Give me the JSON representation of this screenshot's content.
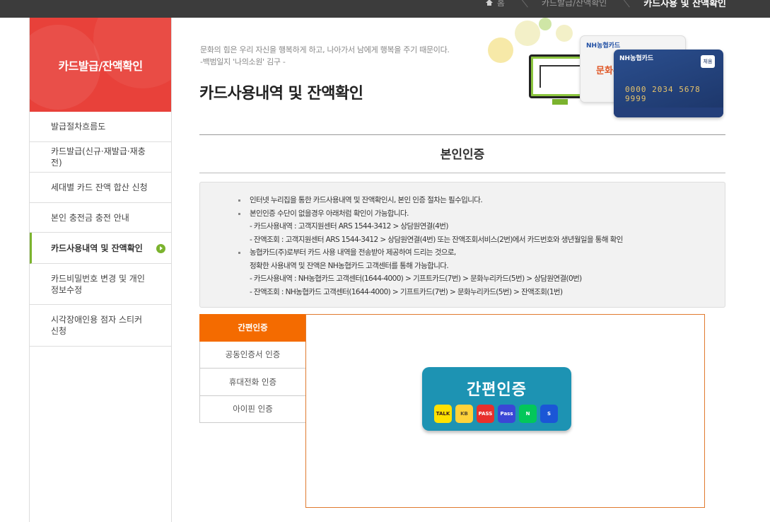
{
  "breadcrumb": {
    "items": [
      "홈",
      "카드발급/잔액확인",
      "카드사용 및 잔액확인"
    ]
  },
  "sidebar": {
    "title": "카드발급/잔액확인",
    "items": [
      {
        "label": "발급절차흐름도"
      },
      {
        "label": "카드발급(신규·재발급·재충전)"
      },
      {
        "label": "세대별 카드 잔액 합산 신청"
      },
      {
        "label": "본인 충전금 충전 안내"
      },
      {
        "label": "카드사용내역 및 잔액확인",
        "active": true
      },
      {
        "label": "카드비밀번호 변경 및 개인\n정보수정"
      },
      {
        "label": "시각장애인용 점자 스티커\n신청"
      }
    ]
  },
  "header": {
    "quote_line1": "문화의 힘은 우리 자신을 행복하게 하고, 나아가서 남에게 행복을 주기 때문이다.",
    "quote_line2": "-백범일지 '나의소원' 김구 -",
    "title": "카드사용내역 및 잔액확인"
  },
  "illustration": {
    "card1_logo": "NH농협카드",
    "card1_brand": "문화누리",
    "card2_logo": "NH농협카드",
    "card2_number": "0000 2034 5678 9999",
    "card2_chip": "체움"
  },
  "section": {
    "title": "본인인증"
  },
  "info": {
    "lines": [
      {
        "text": "인터넷 누리집을 통한 카드사용내역 및 잔액확인시, 본인 인증 절차는 필수입니다.",
        "bullet": true
      },
      {
        "text": "본인인증 수단이 없을경우 아래처럼 확인이 가능합니다.",
        "bullet": true
      },
      {
        "text": "- 카드사용내역 : 고객지원센터 ARS 1544-3412 > 상담원연결(4번)",
        "bullet": false
      },
      {
        "text": "- 잔액조회 : 고객지원센터 ARS 1544-3412 > 상담원연결(4번) 또는 잔액조회서비스(2번)에서 카드번호와 생년월일을 통해 확인",
        "bullet": false
      },
      {
        "text": "농협카드(주)로부터 카드 사용 내역을 전송받아 제공하여 드리는 것으로,",
        "bullet": true
      },
      {
        "text": "정확한 사용내역 및 잔액은 NH농협카드 고객센터를 통해 가능합니다.",
        "bullet": false
      },
      {
        "text": "- 카드사용내역 : NH농협카드 고객센터(1644-4000) > 기프트카드(7번) > 문화누리카드(5번) > 상담원연결(0번)",
        "bullet": false
      },
      {
        "text": "- 잔액조회 : NH농협카드 고객센터(1644-4000) > 기프트카드(7번) > 문화누리카드(5번) > 잔액조회(1번)",
        "bullet": false
      }
    ]
  },
  "auth_tabs": [
    {
      "label": "간편인증",
      "active": true
    },
    {
      "label": "공동인증서 인증"
    },
    {
      "label": "휴대전화 인증"
    },
    {
      "label": "아이핀 인증"
    }
  ],
  "simple_auth": {
    "title": "간편인증",
    "apps": [
      {
        "name": "kakaotalk-icon",
        "label": "TALK",
        "bg": "#ffe100",
        "fg": "#3a1d1d"
      },
      {
        "name": "kb-icon",
        "label": "KB",
        "bg": "#ffd23a",
        "fg": "#5a4a2a"
      },
      {
        "name": "pass-red-icon",
        "label": "PASS",
        "bg": "#e8302c",
        "fg": "#ffffff"
      },
      {
        "name": "pass-blue-icon",
        "label": "Pass",
        "bg": "#3b47d6",
        "fg": "#ffffff"
      },
      {
        "name": "naver-icon",
        "label": "N",
        "bg": "#03c75a",
        "fg": "#ffffff"
      },
      {
        "name": "shinhan-icon",
        "label": "S",
        "bg": "#1b56d6",
        "fg": "#ffffff"
      }
    ]
  }
}
